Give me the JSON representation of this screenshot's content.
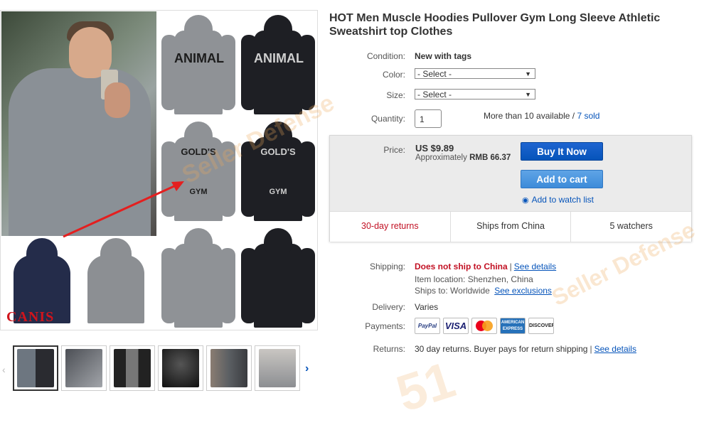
{
  "product": {
    "title": "HOT Men Muscle Hoodies Pullover Gym Long Sleeve Athletic Sweatshirt top Clothes"
  },
  "gallery": {
    "brand_text": "CANIS",
    "print_animal": "ANIMAL",
    "print_golds": "GOLD'S",
    "print_gym": "GYM",
    "thumbnail_count": 6
  },
  "details": {
    "condition_label": "Condition:",
    "condition_value": "New with tags",
    "color_label": "Color:",
    "color_value": "- Select -",
    "size_label": "Size:",
    "size_value": "- Select -",
    "quantity_label": "Quantity:",
    "quantity_value": "1",
    "availability": "More than 10 available /",
    "sold": "7 sold"
  },
  "purchase": {
    "price_label": "Price:",
    "price": "US $9.89",
    "approx_prefix": "Approximately",
    "approx_value": "RMB 66.37",
    "buy_now": "Buy It Now",
    "add_to_cart": "Add to cart",
    "watch_list": "Add to watch list",
    "returns_badge": "30-day returns",
    "ships_from": "Ships from China",
    "watchers": "5 watchers"
  },
  "shipping": {
    "shipping_label": "Shipping:",
    "shipping_value": "Does not ship to China",
    "see_details": "See details",
    "item_location": "Item location:",
    "item_location_value": "Shenzhen, China",
    "ships_to": "Ships to:",
    "ships_to_value": "Worldwide",
    "see_exclusions": "See exclusions",
    "delivery_label": "Delivery:",
    "delivery_value": "Varies",
    "payments_label": "Payments:",
    "payment_paypal": "PayPal",
    "payment_visa": "VISA",
    "payment_amex": "AMERICAN EXPRESS",
    "payment_discover": "DISCOVER",
    "returns_label": "Returns:",
    "returns_value": "30 day returns. Buyer pays for return shipping",
    "returns_details": "See details"
  },
  "watermark": {
    "text": "Seller Defense",
    "logo": "51"
  },
  "colors": {
    "link": "#0654ba",
    "buy_button": "#0654ba",
    "cart_button": "#3d8bd9",
    "alert_red": "#c21124"
  }
}
